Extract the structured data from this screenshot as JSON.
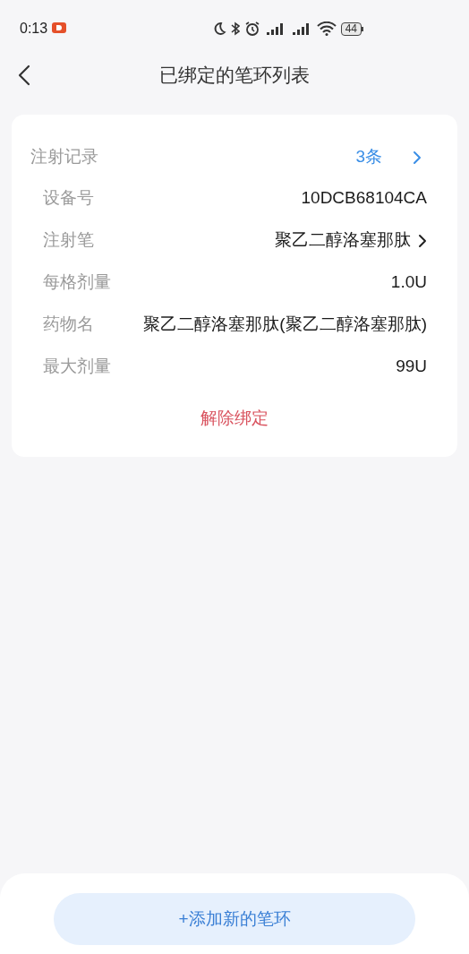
{
  "status_bar": {
    "time": "0:13",
    "battery": "44"
  },
  "header": {
    "title": "已绑定的笔环列表"
  },
  "card": {
    "record": {
      "label": "注射记录",
      "value": "3条"
    },
    "rows": [
      {
        "label": "设备号",
        "value": "10DCB68104CA",
        "chevron": false
      },
      {
        "label": "注射笔",
        "value": "聚乙二醇洛塞那肽",
        "chevron": true
      },
      {
        "label": "每格剂量",
        "value": "1.0U",
        "chevron": false
      },
      {
        "label": "药物名",
        "value": "聚乙二醇洛塞那肽(聚乙二醇洛塞那肽)",
        "chevron": false
      },
      {
        "label": "最大剂量",
        "value": "99U",
        "chevron": false
      }
    ],
    "unbind": "解除绑定"
  },
  "add_button": "+添加新的笔环"
}
